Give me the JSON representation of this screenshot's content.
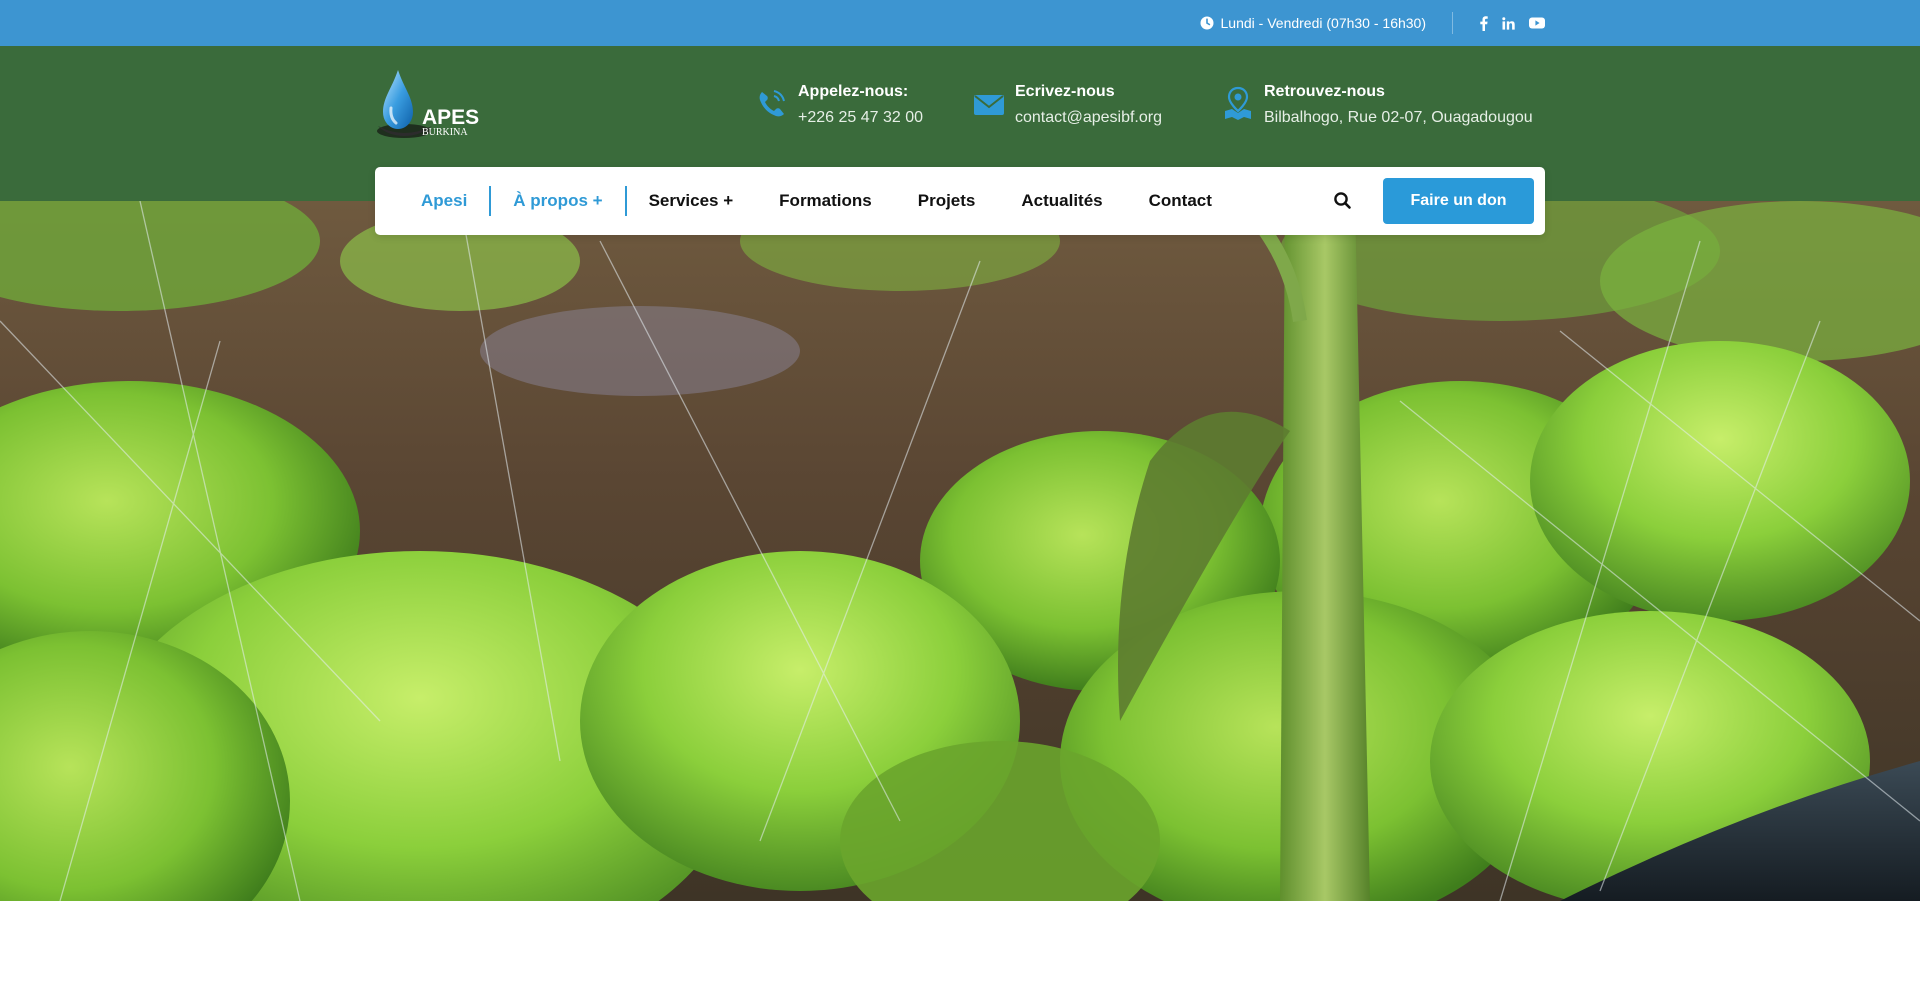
{
  "topbar": {
    "hours": "Lundi - Vendredi (07h30 - 16h30)",
    "socials": [
      "facebook-icon",
      "linkedin-icon",
      "youtube-icon"
    ],
    "background": "#3d95d1"
  },
  "header": {
    "background": "#3a6b3b",
    "logo": {
      "name": "APESI",
      "sub": "BURKINA"
    },
    "contacts": [
      {
        "icon": "phone-icon",
        "title": "Appelez-nous:",
        "value": "+226 25 47 32 00"
      },
      {
        "icon": "mail-icon",
        "title": "Ecrivez-nous",
        "value": "contact@apesibf.org"
      },
      {
        "icon": "location-icon",
        "title": "Retrouvez-nous",
        "value": "Bilbalhogo, Rue 02-07, Ouagadougou"
      }
    ]
  },
  "nav": {
    "items": [
      {
        "label": "Apesi",
        "active": true
      },
      {
        "label": "À propos +",
        "active": true
      },
      {
        "label": "Services +",
        "active": false
      },
      {
        "label": "Formations",
        "active": false
      },
      {
        "label": "Projets",
        "active": false
      },
      {
        "label": "Actualités",
        "active": false
      },
      {
        "label": "Contact",
        "active": false
      }
    ],
    "donate_label": "Faire un don",
    "accent": "#2a9ad9"
  },
  "hero": {
    "image": "lettuce-field-irrigation-photo"
  }
}
